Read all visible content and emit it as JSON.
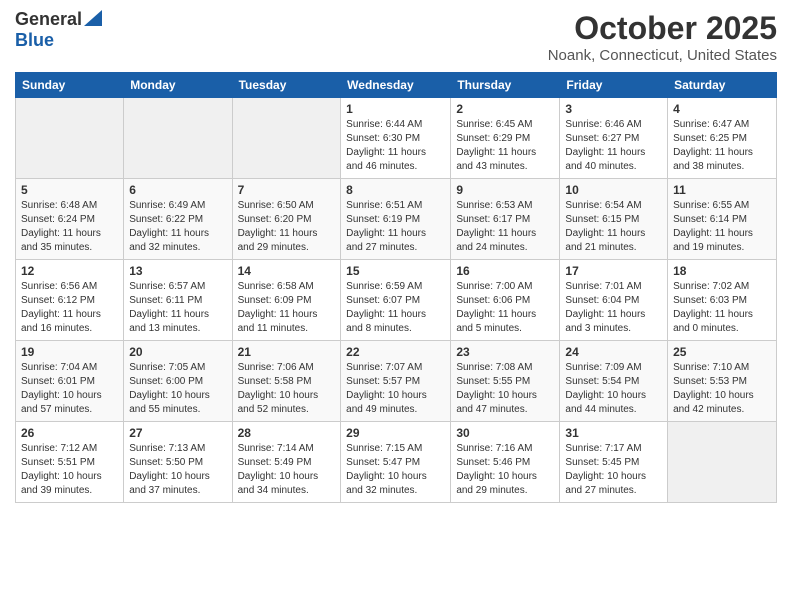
{
  "header": {
    "logo_general": "General",
    "logo_blue": "Blue",
    "month_title": "October 2025",
    "location": "Noank, Connecticut, United States"
  },
  "days_of_week": [
    "Sunday",
    "Monday",
    "Tuesday",
    "Wednesday",
    "Thursday",
    "Friday",
    "Saturday"
  ],
  "weeks": [
    [
      {
        "day": "",
        "empty": true
      },
      {
        "day": "",
        "empty": true
      },
      {
        "day": "",
        "empty": true
      },
      {
        "day": "1",
        "sunrise": "6:44 AM",
        "sunset": "6:30 PM",
        "daylight": "11 hours and 46 minutes."
      },
      {
        "day": "2",
        "sunrise": "6:45 AM",
        "sunset": "6:29 PM",
        "daylight": "11 hours and 43 minutes."
      },
      {
        "day": "3",
        "sunrise": "6:46 AM",
        "sunset": "6:27 PM",
        "daylight": "11 hours and 40 minutes."
      },
      {
        "day": "4",
        "sunrise": "6:47 AM",
        "sunset": "6:25 PM",
        "daylight": "11 hours and 38 minutes."
      }
    ],
    [
      {
        "day": "5",
        "sunrise": "6:48 AM",
        "sunset": "6:24 PM",
        "daylight": "11 hours and 35 minutes."
      },
      {
        "day": "6",
        "sunrise": "6:49 AM",
        "sunset": "6:22 PM",
        "daylight": "11 hours and 32 minutes."
      },
      {
        "day": "7",
        "sunrise": "6:50 AM",
        "sunset": "6:20 PM",
        "daylight": "11 hours and 29 minutes."
      },
      {
        "day": "8",
        "sunrise": "6:51 AM",
        "sunset": "6:19 PM",
        "daylight": "11 hours and 27 minutes."
      },
      {
        "day": "9",
        "sunrise": "6:53 AM",
        "sunset": "6:17 PM",
        "daylight": "11 hours and 24 minutes."
      },
      {
        "day": "10",
        "sunrise": "6:54 AM",
        "sunset": "6:15 PM",
        "daylight": "11 hours and 21 minutes."
      },
      {
        "day": "11",
        "sunrise": "6:55 AM",
        "sunset": "6:14 PM",
        "daylight": "11 hours and 19 minutes."
      }
    ],
    [
      {
        "day": "12",
        "sunrise": "6:56 AM",
        "sunset": "6:12 PM",
        "daylight": "11 hours and 16 minutes."
      },
      {
        "day": "13",
        "sunrise": "6:57 AM",
        "sunset": "6:11 PM",
        "daylight": "11 hours and 13 minutes."
      },
      {
        "day": "14",
        "sunrise": "6:58 AM",
        "sunset": "6:09 PM",
        "daylight": "11 hours and 11 minutes."
      },
      {
        "day": "15",
        "sunrise": "6:59 AM",
        "sunset": "6:07 PM",
        "daylight": "11 hours and 8 minutes."
      },
      {
        "day": "16",
        "sunrise": "7:00 AM",
        "sunset": "6:06 PM",
        "daylight": "11 hours and 5 minutes."
      },
      {
        "day": "17",
        "sunrise": "7:01 AM",
        "sunset": "6:04 PM",
        "daylight": "11 hours and 3 minutes."
      },
      {
        "day": "18",
        "sunrise": "7:02 AM",
        "sunset": "6:03 PM",
        "daylight": "11 hours and 0 minutes."
      }
    ],
    [
      {
        "day": "19",
        "sunrise": "7:04 AM",
        "sunset": "6:01 PM",
        "daylight": "10 hours and 57 minutes."
      },
      {
        "day": "20",
        "sunrise": "7:05 AM",
        "sunset": "6:00 PM",
        "daylight": "10 hours and 55 minutes."
      },
      {
        "day": "21",
        "sunrise": "7:06 AM",
        "sunset": "5:58 PM",
        "daylight": "10 hours and 52 minutes."
      },
      {
        "day": "22",
        "sunrise": "7:07 AM",
        "sunset": "5:57 PM",
        "daylight": "10 hours and 49 minutes."
      },
      {
        "day": "23",
        "sunrise": "7:08 AM",
        "sunset": "5:55 PM",
        "daylight": "10 hours and 47 minutes."
      },
      {
        "day": "24",
        "sunrise": "7:09 AM",
        "sunset": "5:54 PM",
        "daylight": "10 hours and 44 minutes."
      },
      {
        "day": "25",
        "sunrise": "7:10 AM",
        "sunset": "5:53 PM",
        "daylight": "10 hours and 42 minutes."
      }
    ],
    [
      {
        "day": "26",
        "sunrise": "7:12 AM",
        "sunset": "5:51 PM",
        "daylight": "10 hours and 39 minutes."
      },
      {
        "day": "27",
        "sunrise": "7:13 AM",
        "sunset": "5:50 PM",
        "daylight": "10 hours and 37 minutes."
      },
      {
        "day": "28",
        "sunrise": "7:14 AM",
        "sunset": "5:49 PM",
        "daylight": "10 hours and 34 minutes."
      },
      {
        "day": "29",
        "sunrise": "7:15 AM",
        "sunset": "5:47 PM",
        "daylight": "10 hours and 32 minutes."
      },
      {
        "day": "30",
        "sunrise": "7:16 AM",
        "sunset": "5:46 PM",
        "daylight": "10 hours and 29 minutes."
      },
      {
        "day": "31",
        "sunrise": "7:17 AM",
        "sunset": "5:45 PM",
        "daylight": "10 hours and 27 minutes."
      },
      {
        "day": "",
        "empty": true
      }
    ]
  ]
}
